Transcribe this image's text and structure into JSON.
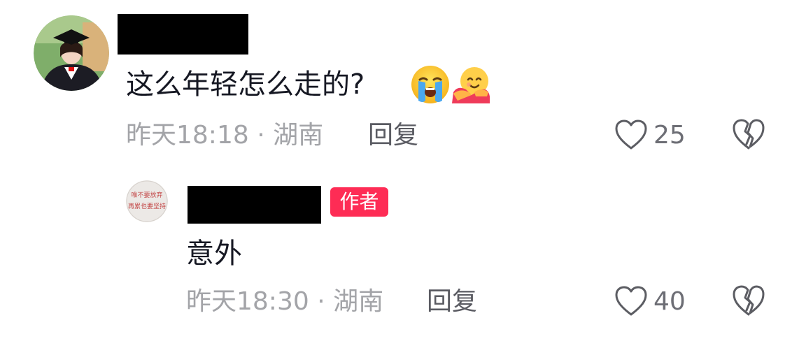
{
  "comment": {
    "text": "这么年轻怎么走的?",
    "emojis": [
      "loudly-crying-face",
      "smiling-face-with-open-hands"
    ],
    "meta": "昨天18:18 · 湖南",
    "reply_label": "回复",
    "like_count": "25"
  },
  "reply": {
    "badge": "作者",
    "avatar_text": "唯不要放弃 再累也要坚持",
    "text": "意外",
    "meta": "昨天18:30 · 湖南",
    "reply_label": "回复",
    "like_count": "40"
  },
  "colors": {
    "badge": "#fe2c55",
    "text": "#161823",
    "meta": "#a3a4a8",
    "icon": "#5c5d63"
  }
}
